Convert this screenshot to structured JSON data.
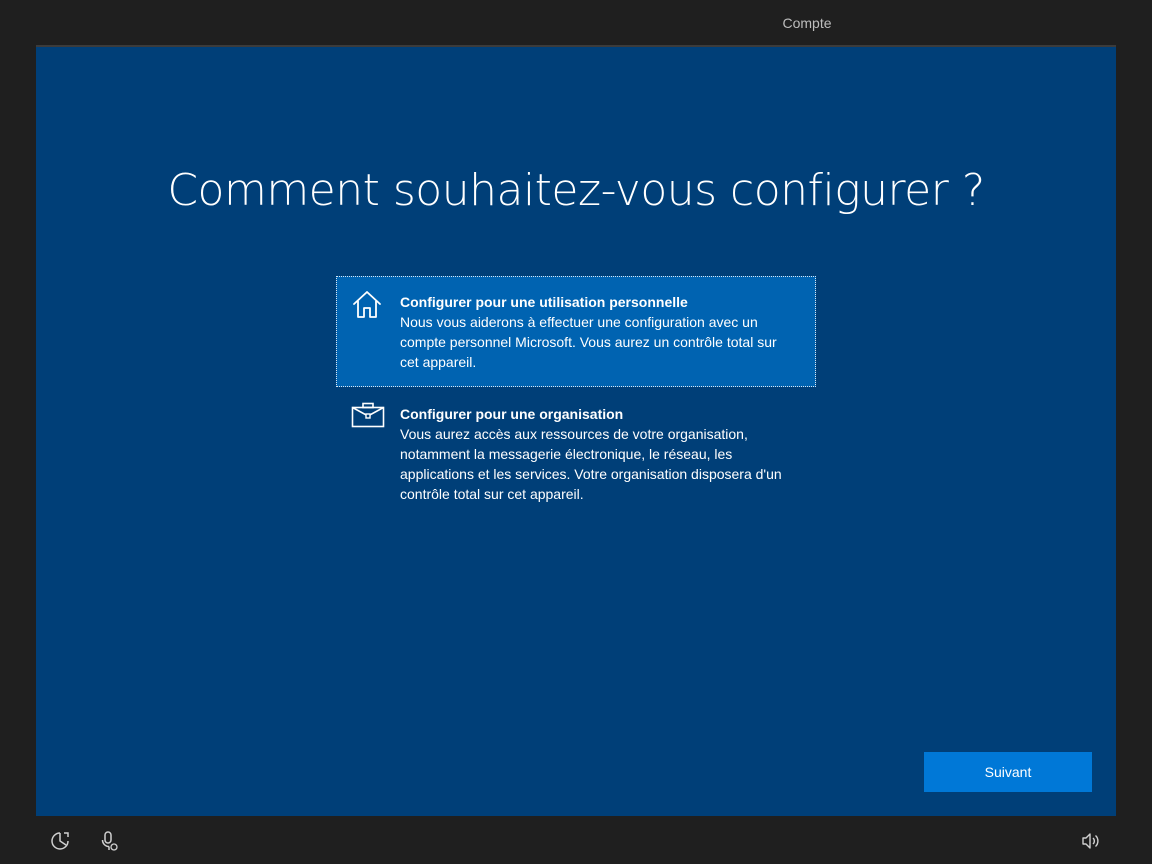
{
  "header": {
    "step_label": "Compte"
  },
  "main": {
    "title": "Comment souhaitez-vous configurer ?",
    "options": [
      {
        "title": "Configurer pour une utilisation personnelle",
        "description": "Nous vous aiderons à effectuer une configuration avec un compte personnel Microsoft. Vous aurez un contrôle total sur cet appareil.",
        "icon": "home-icon",
        "selected": true
      },
      {
        "title": "Configurer pour une organisation",
        "description": "Vous aurez accès aux ressources de votre organisation, notamment la messagerie électronique, le réseau, les applications et les services. Votre organisation disposera d'un contrôle total sur cet appareil.",
        "icon": "briefcase-icon",
        "selected": false
      }
    ],
    "next_label": "Suivant"
  },
  "footer": {
    "icons": [
      "accessibility-icon",
      "microphone-icon",
      "volume-icon"
    ]
  },
  "colors": {
    "panel_background": "#003f78",
    "selected_option": "#0063b1",
    "primary_button": "#0078d7",
    "frame_background": "#1f1f1f"
  }
}
